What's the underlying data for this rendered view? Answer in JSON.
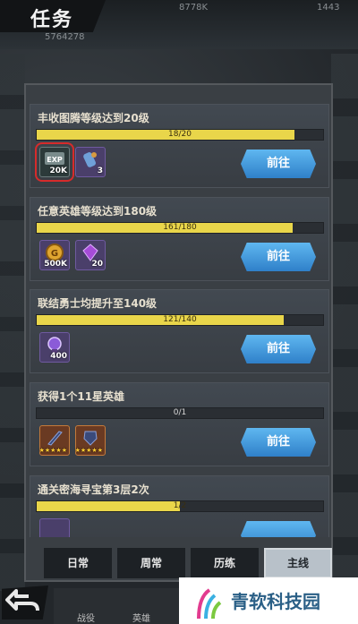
{
  "header": {
    "title": "任务",
    "stat_left": "8778K",
    "stat_right": "1443",
    "power": "5764278"
  },
  "quests": [
    {
      "title": "丰收图腾等级达到20级",
      "progress_text": "18/20",
      "progress": 0.9,
      "rewards": [
        {
          "icon": "exp-scroll-icon",
          "label": "EXP",
          "qty": "20K",
          "highlight": true
        },
        {
          "icon": "scroll-item-icon",
          "qty": "3"
        }
      ],
      "button": "前往"
    },
    {
      "title": "任意英雄等级达到180级",
      "progress_text": "161/180",
      "progress": 0.894,
      "rewards": [
        {
          "icon": "gold-coin-icon",
          "qty": "500K"
        },
        {
          "icon": "purple-gem-icon",
          "qty": "20"
        }
      ],
      "button": "前往"
    },
    {
      "title": "联结勇士均提升至140级",
      "progress_text": "121/140",
      "progress": 0.864,
      "rewards": [
        {
          "icon": "purple-orb-icon",
          "qty": "400"
        }
      ],
      "button": "前往"
    },
    {
      "title": "获得1个11星英雄",
      "progress_text": "0/1",
      "progress": 0.0,
      "rewards": [
        {
          "icon": "weapon-item-icon",
          "qty": ""
        },
        {
          "icon": "armor-item-icon",
          "qty": ""
        }
      ],
      "button": "前往"
    },
    {
      "title": "通关密海寻宝第3层2次",
      "progress_text": "1/2",
      "progress": 0.5,
      "rewards": [],
      "button": ""
    }
  ],
  "tabs": [
    {
      "label": "日常"
    },
    {
      "label": "周常"
    },
    {
      "label": "历练"
    },
    {
      "label": "主线",
      "active": true
    }
  ],
  "bottom_nav": {
    "item1": "战役",
    "item2": "英雄"
  },
  "watermark": {
    "text": "青软科技园"
  },
  "colors": {
    "progress": "#e9d64a",
    "button": "#3a8fd6",
    "highlight": "#d62b2b"
  }
}
